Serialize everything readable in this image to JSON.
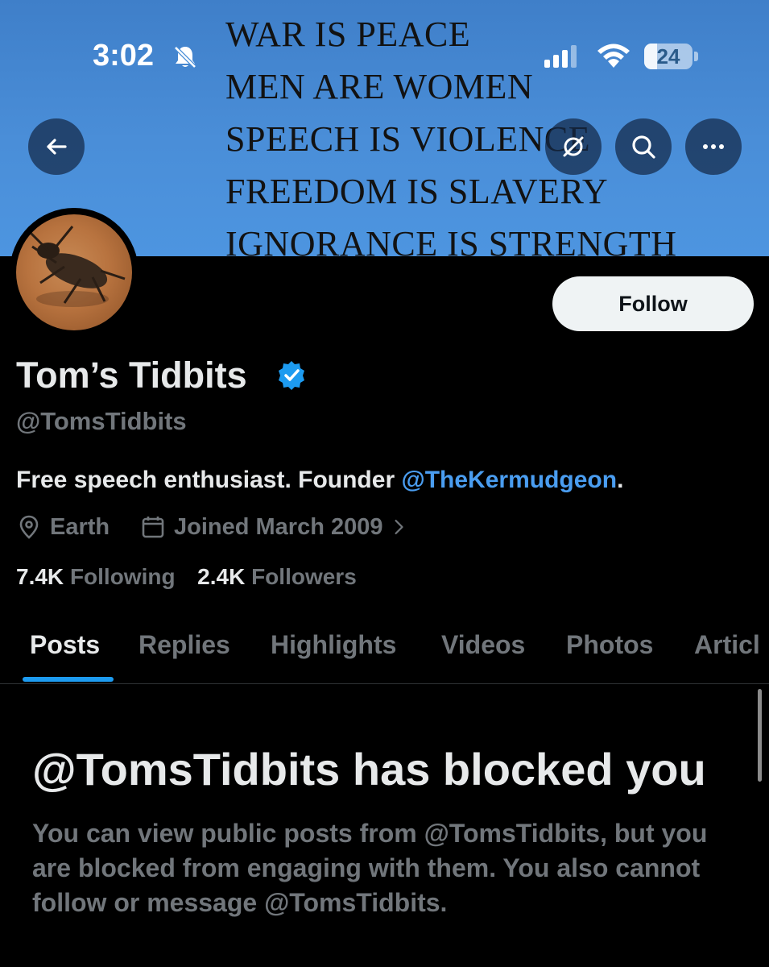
{
  "status_bar": {
    "time": "3:02",
    "battery": "24"
  },
  "banner": {
    "lines": [
      "WAR IS PEACE",
      "MEN ARE WOMEN",
      "SPEECH IS VIOLENCE",
      "FREEDOM IS SLAVERY",
      "IGNORANCE IS STRENGTH"
    ]
  },
  "header_icons": {
    "back": "back-arrow-icon",
    "grok": "grok-icon",
    "search": "search-icon",
    "more": "more-icon"
  },
  "profile": {
    "display_name": "Tom’s Tidbits",
    "handle": "@TomsTidbits",
    "follow_label": "Follow",
    "bio_text": "Free speech enthusiast. Founder ",
    "bio_mention": "@TheKermudgeon",
    "bio_end": ".",
    "location": "Earth",
    "joined": "Joined March 2009",
    "following_count": "7.4K",
    "following_label": "Following",
    "followers_count": "2.4K",
    "followers_label": "Followers"
  },
  "tabs": [
    "Posts",
    "Replies",
    "Highlights",
    "Videos",
    "Photos",
    "Articl"
  ],
  "blocked": {
    "title": "@TomsTidbits has blocked you",
    "body": "You can view public posts from @TomsTidbits, but you are blocked from engaging with them. You also cannot follow or message @TomsTidbits."
  },
  "colors": {
    "accent": "#1d9bf0",
    "mention": "#4a9df0",
    "banner": "#4a8ed8",
    "background": "#000000",
    "muted_text": "#71767b"
  }
}
